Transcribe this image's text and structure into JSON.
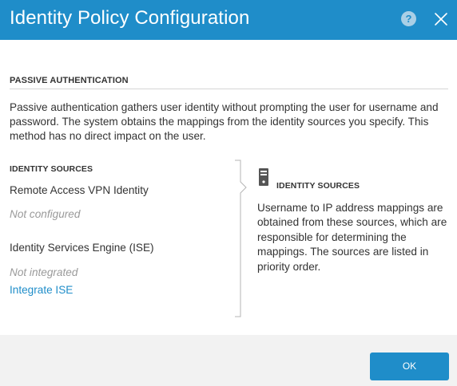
{
  "dialog": {
    "title": "Identity Policy Configuration",
    "help_glyph": "?",
    "accent_color": "#1f8dc9"
  },
  "passive_auth": {
    "heading": "PASSIVE AUTHENTICATION",
    "description": "Passive authentication gathers user identity without prompting the user for username and password. The system obtains the mappings from the identity sources you specify. This method has no direct impact on the user."
  },
  "identity_sources": {
    "heading": "IDENTITY SOURCES",
    "items": [
      {
        "name": "Remote Access VPN Identity",
        "status": "Not configured"
      },
      {
        "name": "Identity Services Engine (ISE)",
        "status": "Not integrated",
        "action": "Integrate ISE"
      }
    ]
  },
  "info_panel": {
    "icon": "server-icon",
    "heading": "IDENTITY SOURCES",
    "text": "Username to IP address mappings are obtained from these sources, which are responsible for determining the mappings. The sources are listed in priority order."
  },
  "footer": {
    "ok_label": "OK"
  }
}
